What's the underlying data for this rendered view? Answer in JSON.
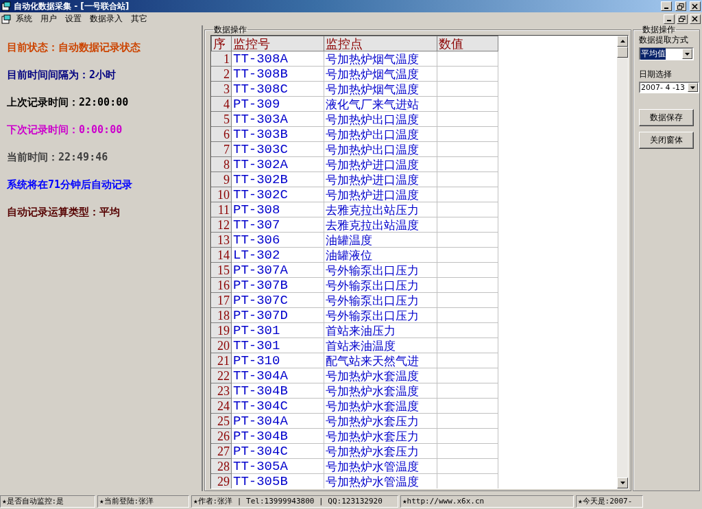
{
  "window": {
    "title": "自动化数据采集 - [一号联合站]"
  },
  "menu": [
    "系统",
    "用户",
    "设置",
    "数据录入",
    "其它"
  ],
  "status_lines": [
    {
      "text": "目前状态：自动数据记录状态",
      "color": "#cc4400"
    },
    {
      "text": "目前时间间隔为：2小时",
      "color": "#000080"
    },
    {
      "text": "上次记录时间：22:00:00",
      "color": "#000000"
    },
    {
      "text": "下次记录时间：0:00:00",
      "color": "#cc00cc"
    },
    {
      "text": "当前时间：22:49:46",
      "color": "#404040"
    },
    {
      "text": "系统将在71分钟后自动记录",
      "color": "#0000ff"
    },
    {
      "text": "自动记录运算类型：平均",
      "color": "#550000"
    }
  ],
  "data_group": {
    "title": "数据操作",
    "table": {
      "columns": [
        "序",
        "监控号",
        "监控点",
        "数值"
      ],
      "rows": [
        [
          "1",
          "TT-308A",
          "号加热炉烟气温度"
        ],
        [
          "2",
          "TT-308B",
          "号加热炉烟气温度"
        ],
        [
          "3",
          "TT-308C",
          "号加热炉烟气温度"
        ],
        [
          "4",
          "PT-309",
          "液化气厂来气进站"
        ],
        [
          "5",
          "TT-303A",
          "号加热炉出口温度"
        ],
        [
          "6",
          "TT-303B",
          "号加热炉出口温度"
        ],
        [
          "7",
          "TT-303C",
          "号加热炉出口温度"
        ],
        [
          "8",
          "TT-302A",
          "号加热炉进口温度"
        ],
        [
          "9",
          "TT-302B",
          "号加热炉进口温度"
        ],
        [
          "10",
          "TT-302C",
          "号加热炉进口温度"
        ],
        [
          "11",
          "PT-308",
          "去雅克拉出站压力"
        ],
        [
          "12",
          "TT-307",
          "去雅克拉出站温度"
        ],
        [
          "13",
          "TT-306",
          "油罐温度"
        ],
        [
          "14",
          "LT-302",
          "油罐液位"
        ],
        [
          "15",
          "PT-307A",
          "号外输泵出口压力"
        ],
        [
          "16",
          "PT-307B",
          "号外输泵出口压力"
        ],
        [
          "17",
          "PT-307C",
          "号外输泵出口压力"
        ],
        [
          "18",
          "PT-307D",
          "号外输泵出口压力"
        ],
        [
          "19",
          "PT-301",
          "首站来油压力"
        ],
        [
          "20",
          "TT-301",
          "首站来油温度"
        ],
        [
          "21",
          "PT-310",
          "配气站来天然气进"
        ],
        [
          "22",
          "TT-304A",
          "号加热炉水套温度"
        ],
        [
          "23",
          "TT-304B",
          "号加热炉水套温度"
        ],
        [
          "24",
          "TT-304C",
          "号加热炉水套温度"
        ],
        [
          "25",
          "PT-304A",
          "号加热炉水套压力"
        ],
        [
          "26",
          "PT-304B",
          "号加热炉水套压力"
        ],
        [
          "27",
          "PT-304C",
          "号加热炉水套压力"
        ],
        [
          "28",
          "TT-305A",
          "号加热炉水管温度"
        ],
        [
          "29",
          "TT-305B",
          "号加热炉水管温度"
        ]
      ]
    }
  },
  "side_group": {
    "title": "数据操作",
    "method_label": "数据提取方式",
    "method_value": "平均值",
    "date_label": "日期选择",
    "date_value": "2007- 4 -13",
    "buttons": [
      "数据保存",
      "关闭窗体"
    ]
  },
  "status_bar": [
    "★是否自动监控:是",
    "★当前登陆:张洋",
    "★作者:张洋 | Tel:13999943800 | QQ:123132920",
    "★http://www.x6x.cn",
    "★今天是:2007-"
  ]
}
